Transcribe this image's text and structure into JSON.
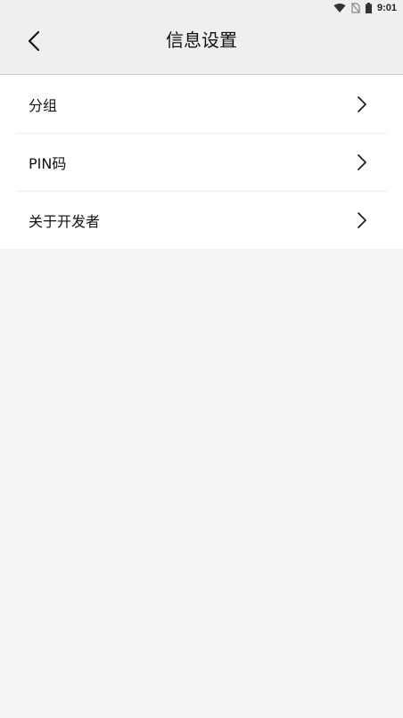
{
  "status_bar": {
    "time": "9:01",
    "icons": [
      "wifi-icon",
      "no-sim-icon",
      "battery-icon"
    ]
  },
  "header": {
    "title": "信息设置",
    "back_icon": "chevron-left-icon"
  },
  "settings_list": {
    "items": [
      {
        "label": "分组",
        "icon": "chevron-right-icon"
      },
      {
        "label": "PIN码",
        "icon": "chevron-right-icon"
      },
      {
        "label": "关于开发者",
        "icon": "chevron-right-icon"
      }
    ]
  },
  "colors": {
    "header_bg": "#efefef",
    "page_bg": "#f4f4f4",
    "list_bg": "#ffffff",
    "text": "#111111"
  }
}
